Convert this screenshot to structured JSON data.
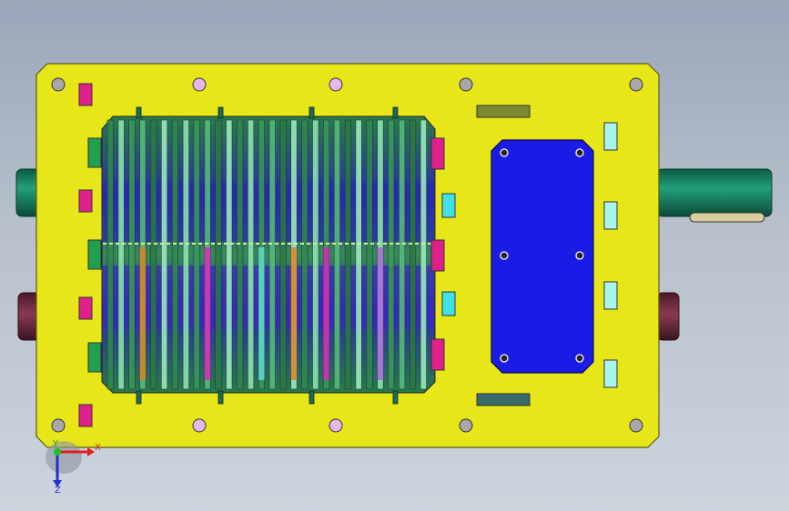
{
  "viewport": {
    "background_top": "#9aa7b8",
    "background_bottom": "#cdd4dd"
  },
  "model": {
    "plate_color": "#e6e619",
    "plate_edge_color": "#5c5c10",
    "cover_color": "#1b1be6",
    "shaft_color": "#0f7a5a",
    "boss_color": "#6a2a3a",
    "cutter_green": "#3a9a5a",
    "cutter_light": "#86e0a0",
    "rotor_blue": "#2a2ab0",
    "highlight_magenta": "#e020c0",
    "highlight_orange": "#e08020",
    "bolt_hole_color": "#a0a0a0",
    "pin_hole_color": "#e0b0e8",
    "slot_magenta": "#e0208a",
    "slot_cyan": "#40e0e8",
    "slot_green": "#20a050",
    "bar_olive": "#7a8a30",
    "bar_teal": "#3a6a6a"
  },
  "triad": {
    "x_label": "X",
    "y_label": "Y",
    "z_label": "Z",
    "x_color": "#e02020",
    "y_color": "#20c020",
    "z_color": "#2030d0"
  }
}
